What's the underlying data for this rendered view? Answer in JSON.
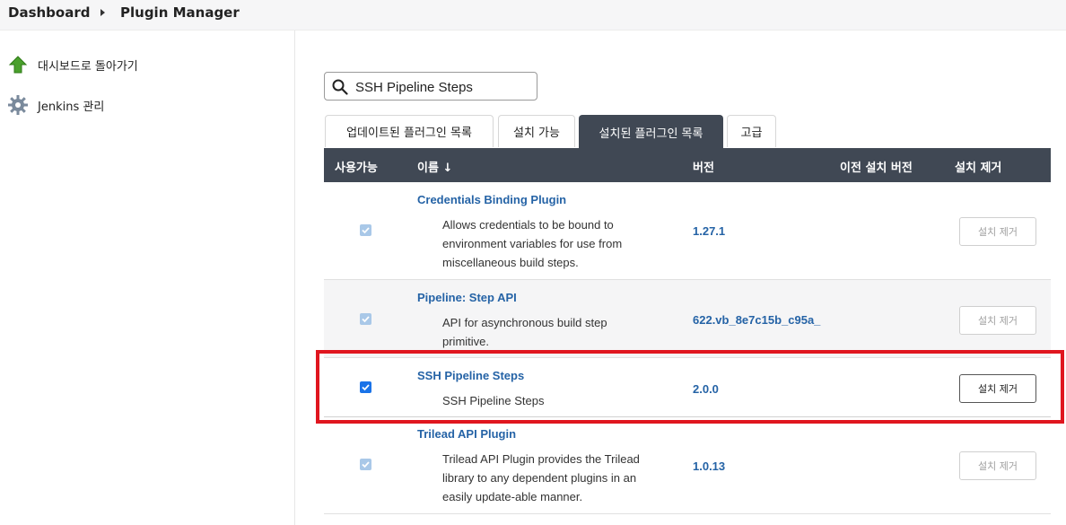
{
  "breadcrumb": {
    "items": [
      "Dashboard",
      "Plugin Manager"
    ]
  },
  "sidebar": {
    "items": [
      {
        "label": "대시보드로 돌아가기",
        "icon": "up-arrow-icon"
      },
      {
        "label": "Jenkins 관리",
        "icon": "gear-icon"
      }
    ]
  },
  "search": {
    "value": "SSH Pipeline Steps"
  },
  "tabs": [
    {
      "label": "업데이트된 플러그인 목록",
      "active": false
    },
    {
      "label": "설치 가능",
      "active": false
    },
    {
      "label": "설치된 플러그인 목록",
      "active": true
    },
    {
      "label": "고급",
      "active": false
    }
  ],
  "table": {
    "headers": {
      "enabled": "사용가능",
      "name": "이름 ↓",
      "version": "버전",
      "previous": "이전 설치 버전",
      "uninstall": "설치 제거"
    },
    "rows": [
      {
        "name": "Credentials Binding Plugin",
        "description": "Allows credentials to be bound to environment variables for use from miscellaneous build steps.",
        "version": "1.27.1",
        "checked": true,
        "enabled": false,
        "uninstall_label": "설치 제거",
        "uninstall_enabled": false
      },
      {
        "name": "Pipeline: Step API",
        "description": "API for asynchronous build step primitive.",
        "version": "622.vb_8e7c15b_c95a_",
        "checked": true,
        "enabled": false,
        "uninstall_label": "설치 제거",
        "uninstall_enabled": false
      },
      {
        "name": "SSH Pipeline Steps",
        "description": "SSH Pipeline Steps",
        "version": "2.0.0",
        "checked": true,
        "enabled": true,
        "uninstall_label": "설치 제거",
        "uninstall_enabled": true
      },
      {
        "name": "Trilead API Plugin",
        "description": "Trilead API Plugin provides the Trilead library to any dependent plugins in an easily update-able manner.",
        "version": "1.0.13",
        "checked": true,
        "enabled": false,
        "uninstall_label": "설치 제거",
        "uninstall_enabled": false
      }
    ]
  },
  "colors": {
    "header_bg": "#404854",
    "link": "#2563a6",
    "highlight": "#e0161f",
    "checkbox": "#1a73e8"
  }
}
